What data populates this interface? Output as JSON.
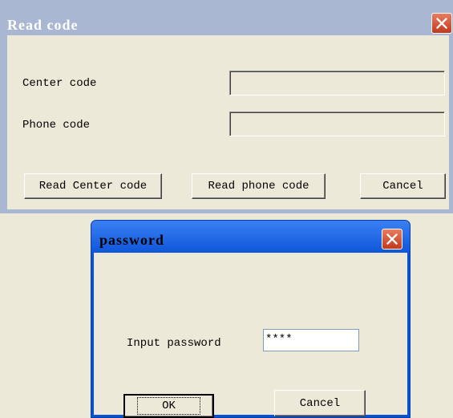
{
  "read_dialog": {
    "title": "Read code",
    "center_label": "Center code",
    "phone_label": "Phone code",
    "center_value": "",
    "phone_value": "",
    "buttons": {
      "read_center": "Read Center code",
      "read_phone": "Read phone code",
      "cancel": "Cancel"
    },
    "close_icon": "close-icon"
  },
  "password_dialog": {
    "title": "password",
    "prompt": "Input password",
    "password_value": "****",
    "buttons": {
      "ok": "OK",
      "cancel": "Cancel"
    },
    "close_icon": "close-icon"
  },
  "colors": {
    "dialog_face": "#ece9d8",
    "inactive_title": "#a9b7d3",
    "active_title": "#0552d6",
    "close_button": "#d6502f"
  }
}
